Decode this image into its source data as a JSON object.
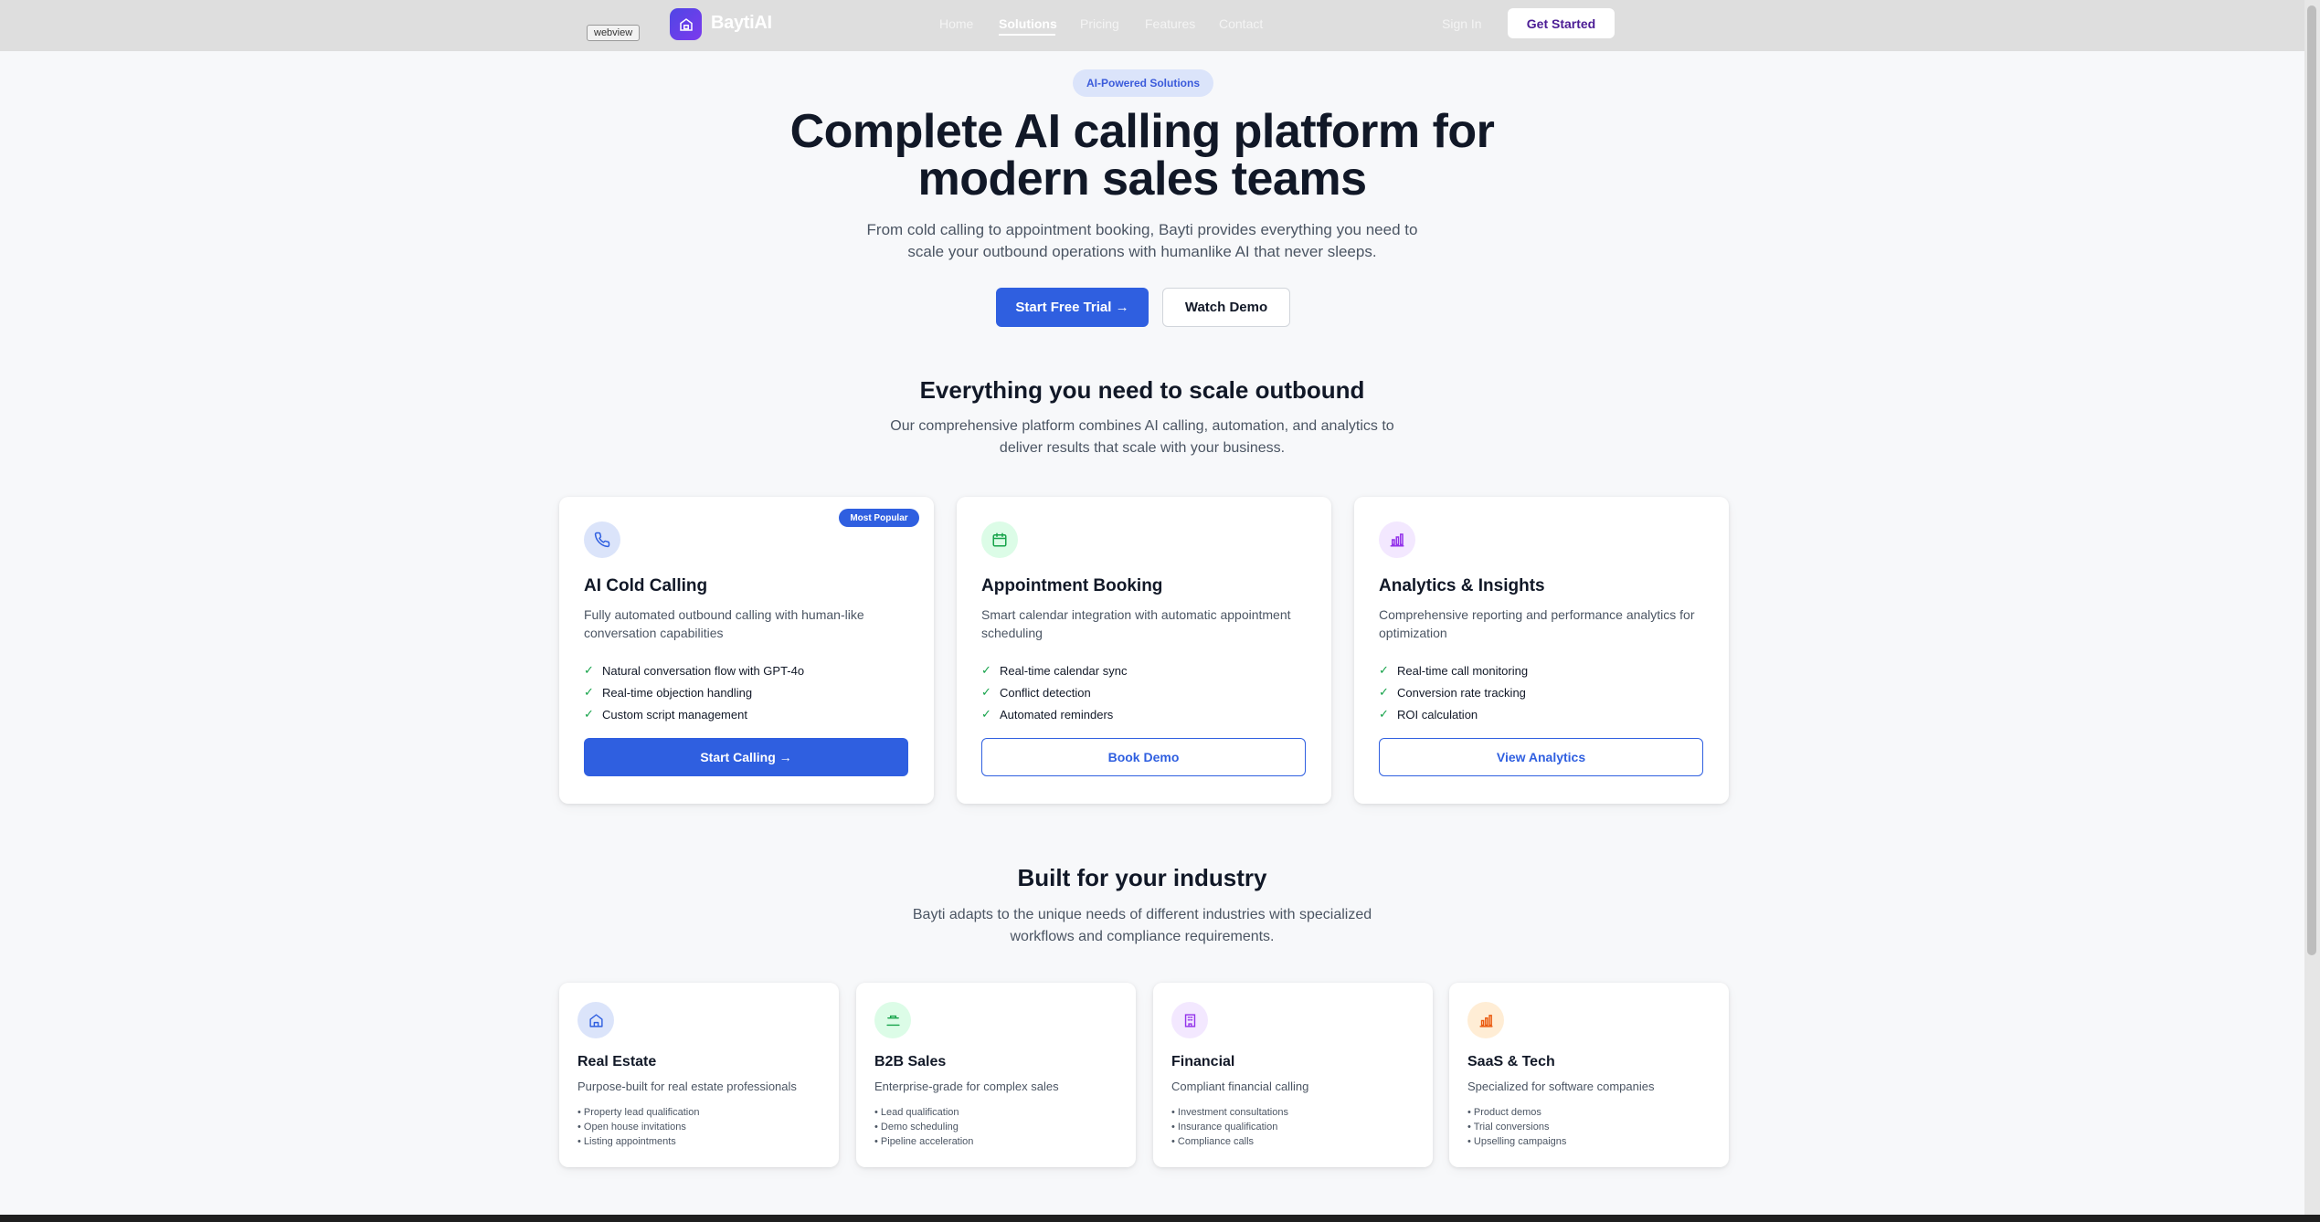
{
  "nav": {
    "webview_tag": "webview",
    "logo_text": "BaytiAI",
    "links": [
      "Home",
      "Solutions",
      "Pricing",
      "Features",
      "Contact"
    ],
    "active_link": "Solutions",
    "sign_in": "Sign In",
    "get_started": "Get Started"
  },
  "hero": {
    "badge": "AI-Powered Solutions",
    "title_line1": "Complete AI calling platform for",
    "title_line2": "modern sales teams",
    "subtitle_line1": "From cold calling to appointment booking, Bayti provides everything you need to",
    "subtitle_line2": "scale your outbound operations with humanlike AI that never sleeps.",
    "primary_button": "Start Free Trial →",
    "secondary_button": "Watch Demo"
  },
  "features_section": {
    "title": "Everything you need to scale outbound",
    "subtitle_line1": "Our comprehensive platform combines AI calling, automation, and analytics to",
    "subtitle_line2": "deliver results that scale with your business.",
    "cards": [
      {
        "icon": "phone-icon",
        "title": "AI Cold Calling",
        "badge": "Most Popular",
        "description": "Fully automated outbound calling with human-like conversation capabilities",
        "items": [
          "Natural conversation flow with GPT-4o",
          "Real-time objection handling",
          "Custom script management"
        ],
        "button": "Start Calling →"
      },
      {
        "icon": "calendar-icon",
        "title": "Appointment Booking",
        "description": "Smart calendar integration with automatic appointment scheduling",
        "items": [
          "Real-time calendar sync",
          "Conflict detection",
          "Automated reminders"
        ],
        "button": "Book Demo"
      },
      {
        "icon": "bar-chart-icon",
        "title": "Analytics & Insights",
        "description": "Comprehensive reporting and performance analytics for optimization",
        "items": [
          "Real-time call monitoring",
          "Conversion rate tracking",
          "ROI calculation"
        ],
        "button": "View Analytics"
      }
    ]
  },
  "industry_section": {
    "title": "Built for your industry",
    "subtitle_line1": "Bayti adapts to the unique needs of different industries with specialized",
    "subtitle_line2": "workflows and compliance requirements.",
    "cards": [
      {
        "icon": "house-icon",
        "title": "Real Estate",
        "description": "Purpose-built for real estate professionals",
        "items": [
          "• Property lead qualification",
          "• Open house invitations",
          "• Listing appointments"
        ]
      },
      {
        "icon": "briefcase-icon",
        "title": "B2B Sales",
        "description": "Enterprise-grade for complex sales",
        "items": [
          "• Lead qualification",
          "• Demo scheduling",
          "• Pipeline acceleration"
        ]
      },
      {
        "icon": "building-icon",
        "title": "Financial",
        "description": "Compliant financial calling",
        "items": [
          "• Investment consultations",
          "• Insurance qualification",
          "• Compliance calls"
        ]
      },
      {
        "icon": "bar-chart-icon",
        "title": "SaaS & Tech",
        "description": "Specialized for software companies",
        "items": [
          "• Product demos",
          "• Trial conversions",
          "• Upselling campaigns"
        ]
      }
    ]
  },
  "colors": {
    "primary": "#2f5fe0",
    "brand_gradient_start": "#4f46e5",
    "brand_gradient_end": "#7c3aed",
    "check": "#16a34a"
  }
}
